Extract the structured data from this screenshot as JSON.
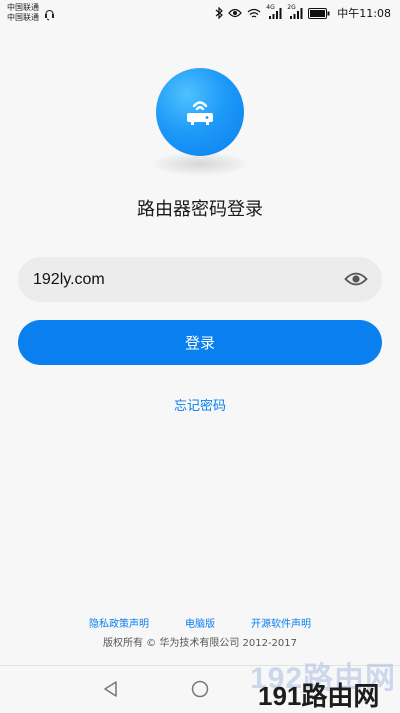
{
  "status_bar": {
    "carrier_1": "中国联通",
    "carrier_2": "中国联通",
    "signal_1_label": "4G",
    "signal_2_label": "2G",
    "time": "中午11:08"
  },
  "login": {
    "title": "路由器密码登录",
    "password_value": "192ly.com",
    "login_button": "登录",
    "forgot_password": "忘记密码"
  },
  "footer": {
    "links": [
      "隐私政策声明",
      "电脑版",
      "开源软件声明"
    ],
    "copyright": "版权所有 © 华为技术有限公司 2012-2017"
  },
  "watermark": {
    "back_text": "192路由网",
    "front_text": "191路由网"
  },
  "colors": {
    "accent": "#0a7ff0",
    "background": "#f7f7f7",
    "field_background": "#ececec"
  },
  "icons": {
    "logo": "router-icon",
    "eye": "eye-icon",
    "back": "back-triangle-icon",
    "home": "home-circle-icon"
  }
}
